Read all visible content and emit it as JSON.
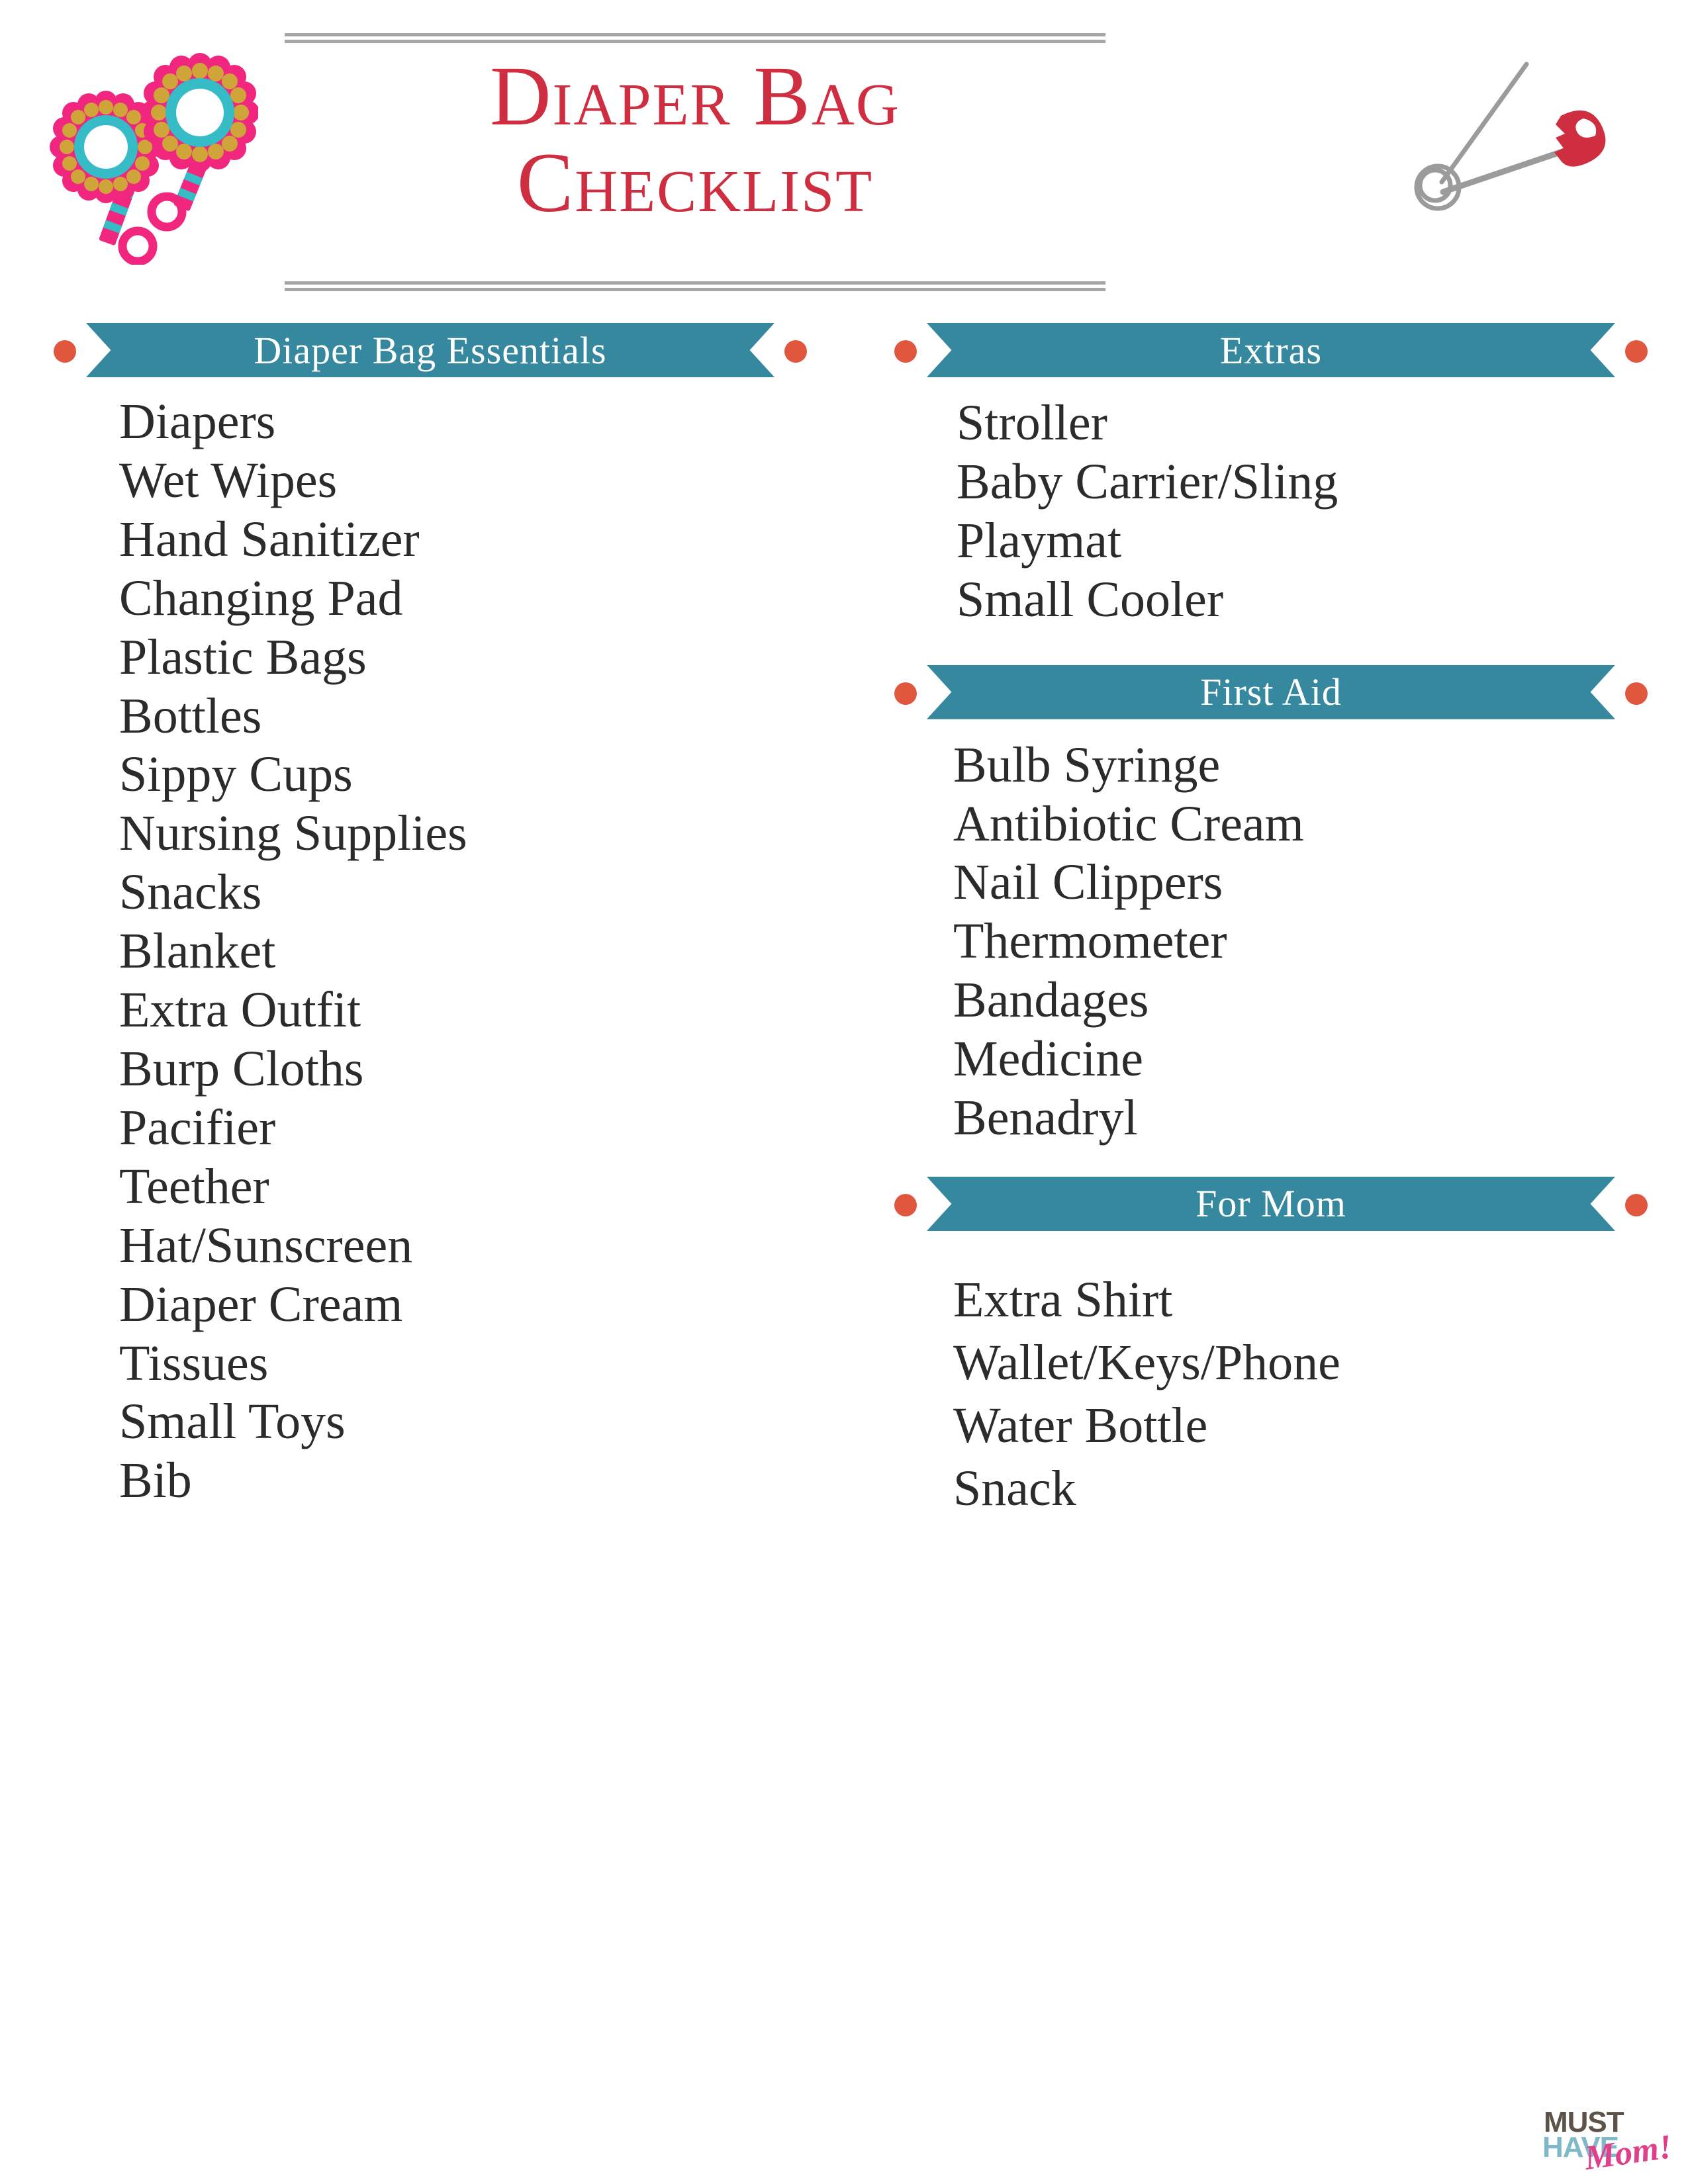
{
  "header": {
    "title_line1": "Diaper Bag",
    "title_line2": "Checklist",
    "title_color": "#cf2e40",
    "rule_color": "#a6a6a6",
    "decor_left_icon": "baby-rattles-icon",
    "decor_right_icon": "safety-pin-icon"
  },
  "theme": {
    "banner_teal": "#35889e",
    "banner_dot": "#e0573e",
    "list_text": "#2b2b2b",
    "rattle_pink": "#f0267f",
    "rattle_gold": "#cfa53a",
    "rattle_teal": "#35bcc6",
    "pin_gray": "#9b9b9b",
    "pin_red": "#cf2e40"
  },
  "left_column": {
    "sections": [
      {
        "id": "diaper-bag-essentials",
        "label": "Diaper Bag Essentials",
        "items": [
          "Diapers",
          "Wet Wipes",
          "Hand Sanitizer",
          "Changing Pad",
          "Plastic Bags",
          "Bottles",
          "Sippy Cups",
          "Nursing Supplies",
          "Snacks",
          "Blanket",
          "Extra Outfit",
          "Burp Cloths",
          "Pacifier",
          "Teether",
          "Hat/Sunscreen",
          "Diaper Cream",
          "Tissues",
          "Small Toys",
          "Bib"
        ]
      }
    ]
  },
  "right_column": {
    "sections": [
      {
        "id": "extras",
        "label": "Extras",
        "items": [
          "Stroller",
          "Baby Carrier/Sling",
          "Playmat",
          "Small Cooler"
        ]
      },
      {
        "id": "first-aid",
        "label": "First Aid",
        "items": [
          "Bulb Syringe",
          "Antibiotic Cream",
          "Nail Clippers",
          "Thermometer",
          "Bandages",
          "Medicine",
          "Benadryl"
        ]
      },
      {
        "id": "for-mom",
        "label": "For Mom",
        "items": [
          "Extra Shirt",
          "Wallet/Keys/Phone",
          "Water Bottle",
          "Snack"
        ]
      }
    ]
  },
  "logo": {
    "line1": "MUST",
    "line2": "HAVE",
    "line3": "Mom!",
    "color1": "#5d5349",
    "color2": "#7fb8c9",
    "color3": "#e0408a"
  }
}
